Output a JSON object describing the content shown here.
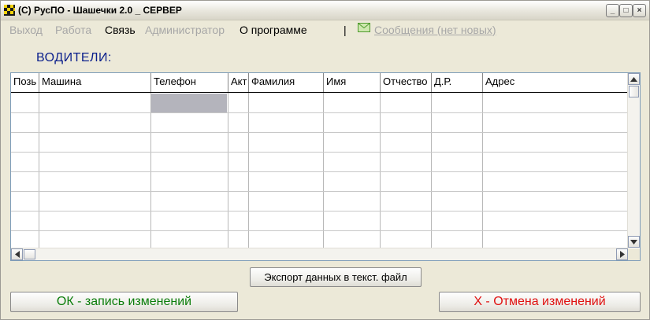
{
  "window": {
    "title": "(C) РусПО - Шашечки 2.0 _ СЕРВЕР",
    "minimize_glyph": "_",
    "maximize_glyph": "□",
    "close_glyph": "×"
  },
  "menu": {
    "items": [
      {
        "label": "Выход",
        "enabled": false
      },
      {
        "label": "Работа",
        "enabled": false
      },
      {
        "label": "Связь",
        "enabled": true
      },
      {
        "label": "Администратор",
        "enabled": false
      },
      {
        "label": "О программе",
        "enabled": true
      }
    ],
    "separator": "|",
    "messages_label": "Сообщения (нет новых)",
    "messages_icon": "envelope-icon"
  },
  "section": {
    "title": "ВОДИТЕЛИ:"
  },
  "grid": {
    "columns": [
      "Позь",
      "Машина",
      "Телефон",
      "Акт",
      "Фамилия",
      "Имя",
      "Отчество",
      "Д.Р.",
      "Адрес"
    ],
    "rows": [
      [
        "",
        "",
        "",
        "",
        "",
        "",
        "",
        "",
        ""
      ],
      [
        "",
        "",
        "",
        "",
        "",
        "",
        "",
        "",
        ""
      ],
      [
        "",
        "",
        "",
        "",
        "",
        "",
        "",
        "",
        ""
      ],
      [
        "",
        "",
        "",
        "",
        "",
        "",
        "",
        "",
        ""
      ],
      [
        "",
        "",
        "",
        "",
        "",
        "",
        "",
        "",
        ""
      ],
      [
        "",
        "",
        "",
        "",
        "",
        "",
        "",
        "",
        ""
      ],
      [
        "",
        "",
        "",
        "",
        "",
        "",
        "",
        "",
        ""
      ],
      [
        "",
        "",
        "",
        "",
        "",
        "",
        "",
        "",
        ""
      ]
    ]
  },
  "buttons": {
    "export": "Экспорт данных в текст. файл",
    "ok": "ОК - запись изменений",
    "cancel": "Х - Отмена изменений"
  },
  "colors": {
    "title_accent": "#0a1f8c",
    "ok_text": "#0a7d0a",
    "cancel_text": "#e01010",
    "disabled_text": "#a7a7a7"
  }
}
